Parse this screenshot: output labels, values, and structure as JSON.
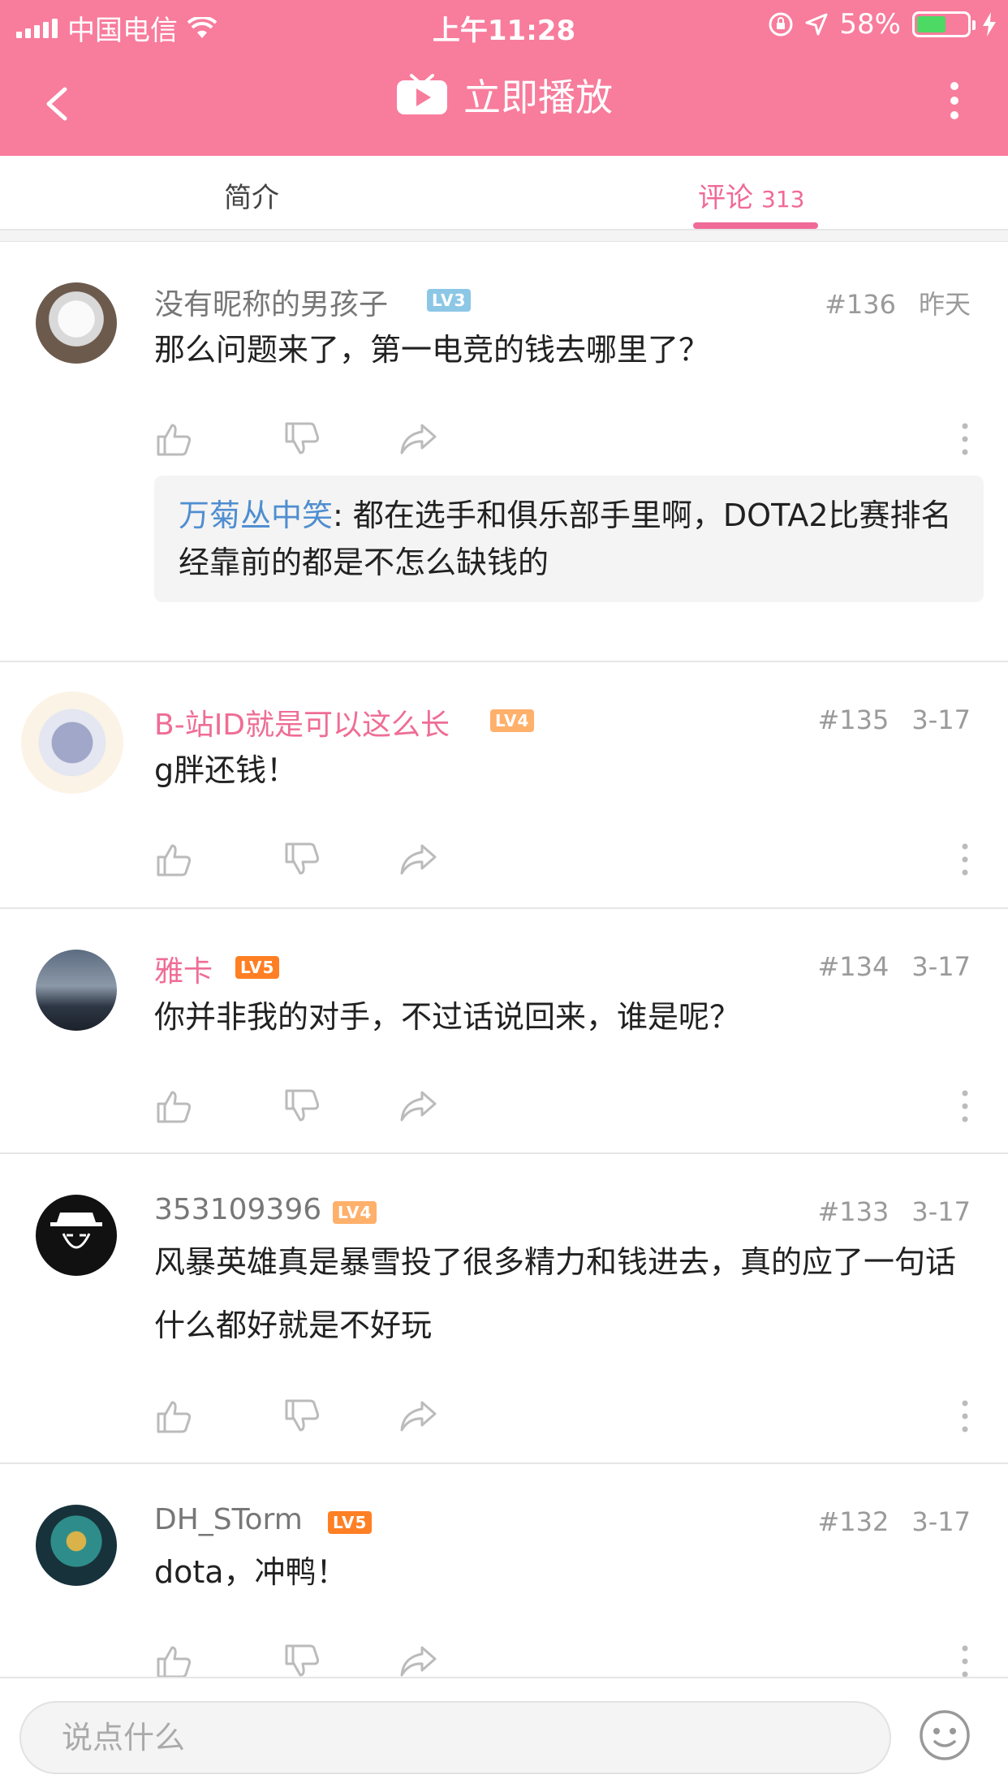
{
  "status": {
    "carrier": "中国电信",
    "time": "上午11:28",
    "battery": "58%",
    "battery_level": 0.58
  },
  "nav": {
    "title": "立即播放"
  },
  "tabs": {
    "intro": "简介",
    "comments": "评论",
    "comments_count": "313"
  },
  "comments": [
    {
      "user": "没有昵称的男孩子",
      "level": "LV3",
      "floor": "#136",
      "time": "昨天",
      "text": "那么问题来了，第一电竞的钱去哪里了？",
      "reply": {
        "user": "万菊丛中笑",
        "text": ": 都在选手和俱乐部手里啊，DOTA2比赛排名经靠前的都是不怎么缺钱的"
      }
    },
    {
      "user": "B-站ID就是可以这么长",
      "level": "LV4",
      "floor": "#135",
      "time": "3-17",
      "text": "g胖还钱！"
    },
    {
      "user": "雅卡",
      "level": "LV5",
      "floor": "#134",
      "time": "3-17",
      "text": "你并非我的对手，不过话说回来，谁是呢？"
    },
    {
      "user": "353109396",
      "level": "LV4",
      "floor": "#133",
      "time": "3-17",
      "text": "风暴英雄真是暴雪投了很多精力和钱进去，真的应了一句话什么都好就是不好玩"
    },
    {
      "user": "DH_STorm",
      "level": "LV5",
      "floor": "#132",
      "time": "3-17",
      "text": "dota，冲鸭！"
    }
  ],
  "composer": {
    "placeholder": "说点什么"
  },
  "colors": {
    "brand": "#f87c9c",
    "accent": "#f06a97",
    "lv3": "#8cc7e6",
    "lv4": "#ffb06b",
    "lv5": "#ff7f24",
    "reply_name": "#4f8ed0"
  }
}
